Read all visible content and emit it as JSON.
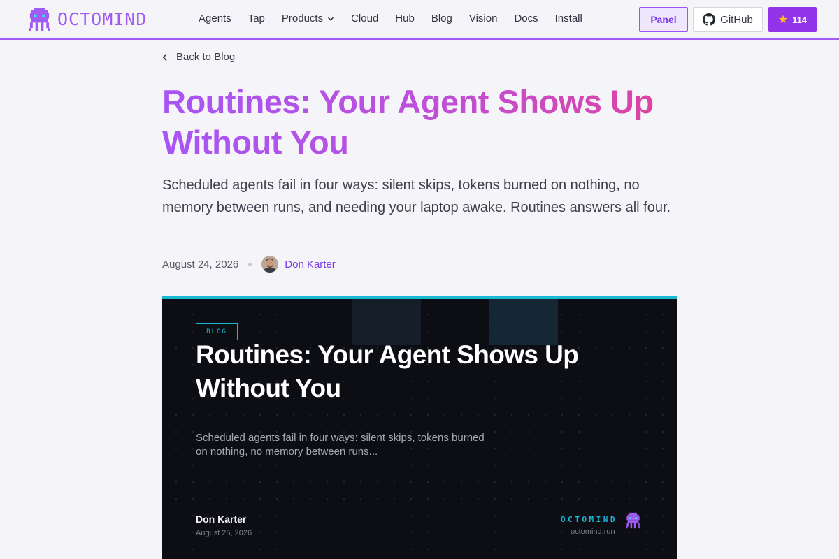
{
  "brand": {
    "name": "OCTOMIND",
    "color": "#a05cf2",
    "logo_icon": "octopus-pixel-icon"
  },
  "nav": {
    "items": [
      {
        "label": "Agents"
      },
      {
        "label": "Tap"
      },
      {
        "label": "Products",
        "has_dropdown": true
      },
      {
        "label": "Cloud"
      },
      {
        "label": "Hub"
      },
      {
        "label": "Blog"
      },
      {
        "label": "Vision"
      },
      {
        "label": "Docs"
      },
      {
        "label": "Install"
      }
    ]
  },
  "actions": {
    "panel_label": "Panel",
    "github_label": "GitHub",
    "star_count": "114",
    "star_icon": "star-icon",
    "accent": "#9333ea"
  },
  "article": {
    "back_label": "Back to Blog",
    "title": "Routines: Your Agent Shows Up Without You",
    "lede": "Scheduled agents fail in four ways: silent skips, tokens burned on nothing, no memory between runs, and needing your laptop awake. Routines answers all four.",
    "date": "August 24, 2026",
    "author": "Don Karter"
  },
  "hero": {
    "badge": "BLOG",
    "title": "Routines: Your Agent Shows Up Without You",
    "subtitle": "Scheduled agents fail in four ways: silent skips, tokens burned on nothing, no memory between runs...",
    "author": "Don Karter",
    "date": "August 25, 2026",
    "brand": "OCTOMIND",
    "domain": "octomind.run",
    "accent": "#16b8d4"
  }
}
